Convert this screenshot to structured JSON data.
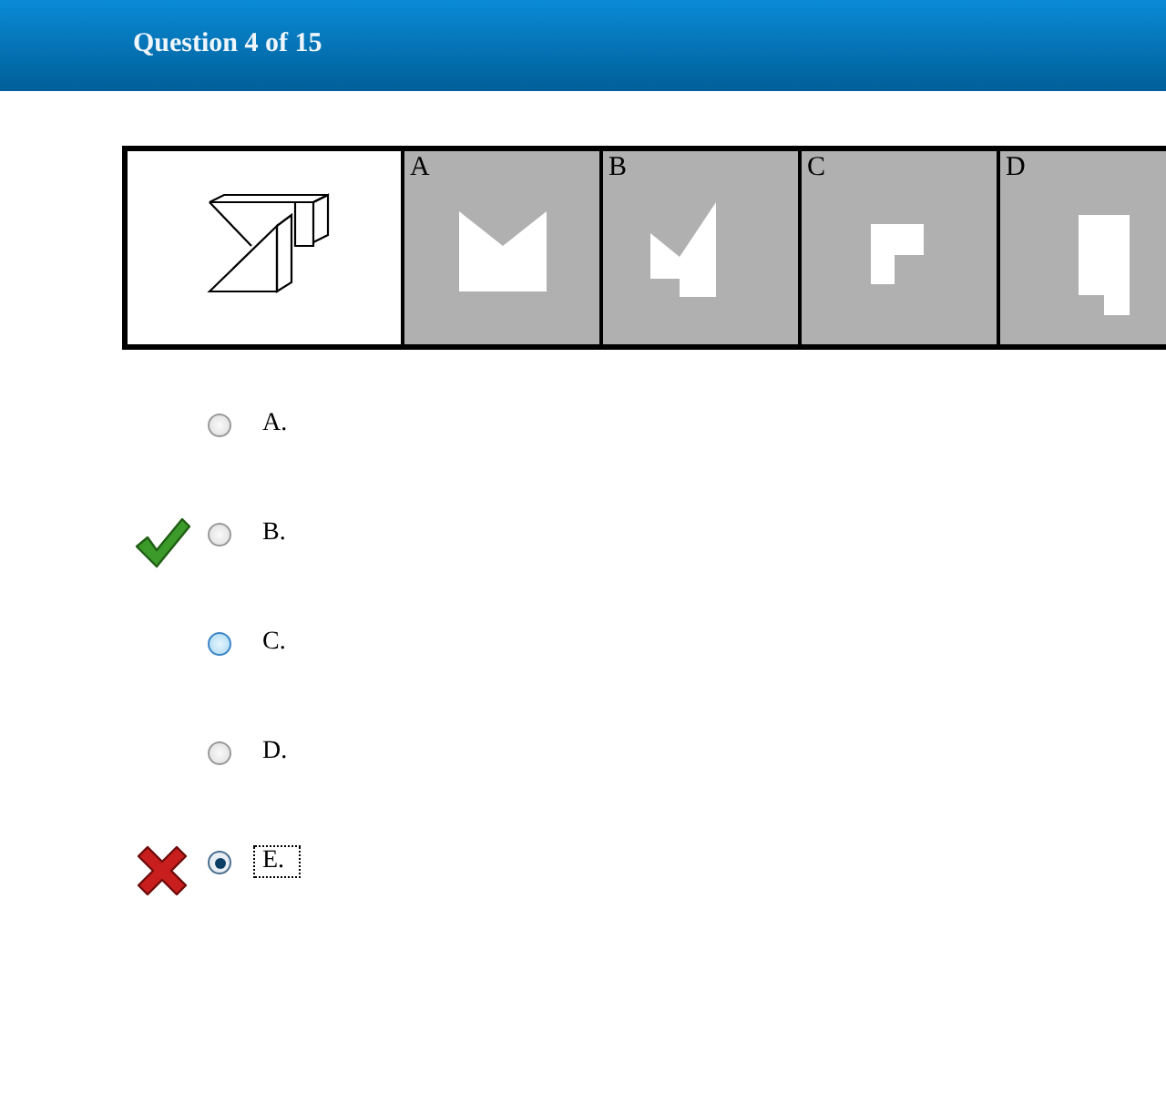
{
  "header": {
    "title": "Question 4 of 15"
  },
  "choices": [
    {
      "label": "A"
    },
    {
      "label": "B"
    },
    {
      "label": "C"
    },
    {
      "label": "D"
    }
  ],
  "options": [
    {
      "label": "A.",
      "selected": false,
      "hovered": false,
      "focused": false,
      "kind": "plain"
    },
    {
      "label": "B.",
      "selected": false,
      "hovered": false,
      "focused": false,
      "kind": "correct"
    },
    {
      "label": "C.",
      "selected": false,
      "hovered": true,
      "focused": false,
      "kind": "plain"
    },
    {
      "label": "D.",
      "selected": false,
      "hovered": false,
      "focused": false,
      "kind": "plain"
    },
    {
      "label": "E.",
      "selected": true,
      "hovered": false,
      "focused": true,
      "kind": "wrong"
    }
  ]
}
